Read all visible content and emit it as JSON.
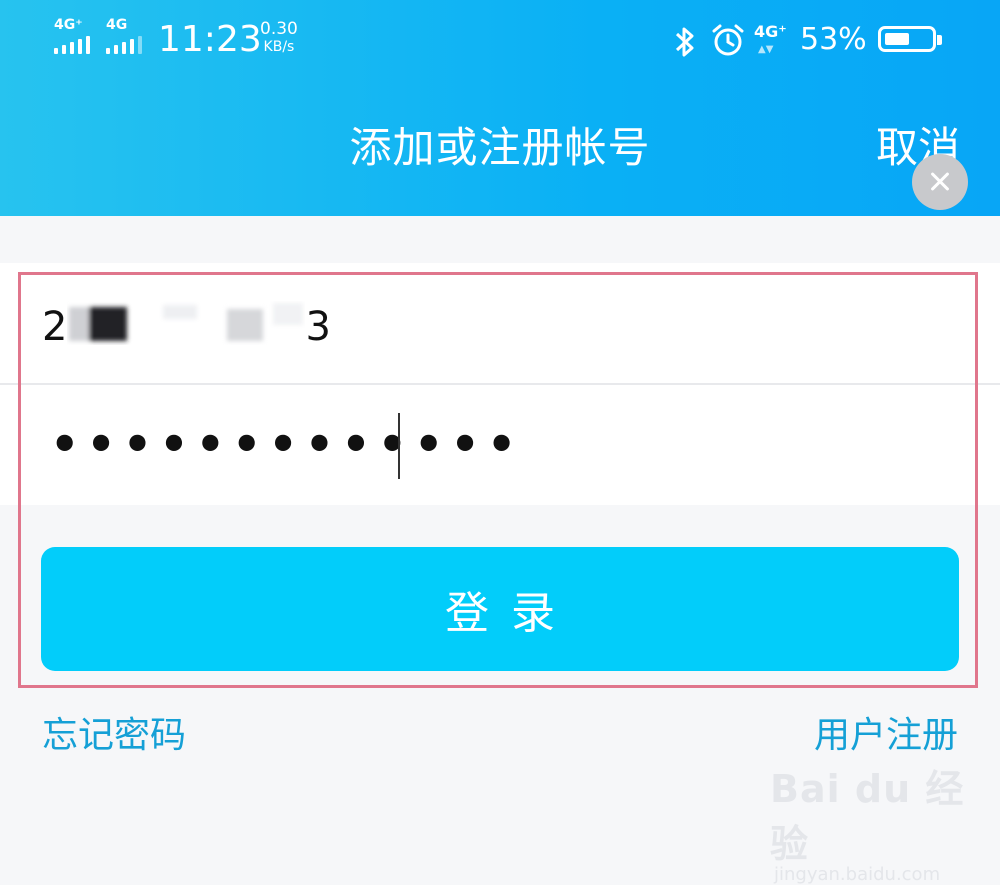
{
  "status_bar": {
    "signal1_label": "4G⁺",
    "signal2_label": "4G",
    "time": "11:23",
    "net_speed_value": "0.30",
    "net_speed_unit": "KB/s",
    "bluetooth_icon": "bluetooth-icon",
    "alarm_icon": "alarm-icon",
    "signal3_label": "4G⁺",
    "battery_percent": "53%",
    "battery_level": 0.53
  },
  "header": {
    "title": "添加或注册帐号",
    "cancel_label": "取消",
    "gradient_start": "#27c3ef",
    "gradient_end": "#08a6f6"
  },
  "form": {
    "account_value_start": "2",
    "account_value_end": "3",
    "password_mask": "•••••••••••••",
    "clear_icon": "clear-icon"
  },
  "login_button": {
    "label": "登录",
    "color": "#02cdfa"
  },
  "links": {
    "forgot_password": "忘记密码",
    "register": "用户注册",
    "color": "#15a0d6"
  },
  "highlight_color": "#e0768c",
  "watermark": {
    "line1": "Bai du 经验",
    "line2": "jingyan.baidu.com"
  }
}
